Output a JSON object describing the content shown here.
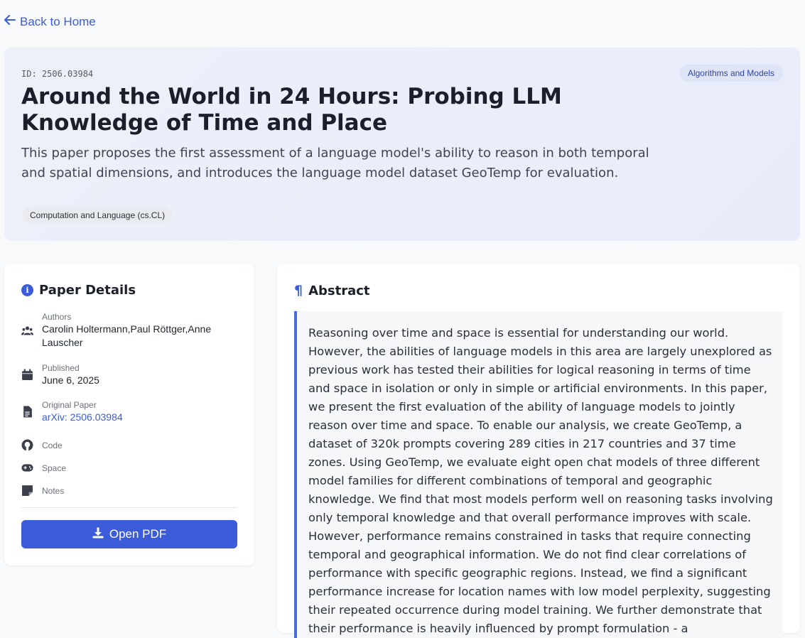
{
  "nav": {
    "back_label": "Back to Home"
  },
  "paper": {
    "id_label": "ID: 2506.03984",
    "category": "Algorithms and Models",
    "title": "Around the World in 24 Hours: Probing LLM Knowledge of Time and Place",
    "summary": "This paper proposes the first assessment of a language model's ability to reason in both temporal and spatial dimensions, and introduces the language model dataset GeoTemp for evaluation.",
    "subject": "Computation and Language (cs.CL)"
  },
  "details": {
    "heading": "Paper Details",
    "authors_label": "Authors",
    "authors": "Carolin Holtermann,Paul Röttger,Anne Lauscher",
    "published_label": "Published",
    "published": "June 6, 2025",
    "original_label": "Original Paper",
    "original_link": "arXiv: 2506.03984",
    "code_label": "Code",
    "space_label": "Space",
    "notes_label": "Notes",
    "open_pdf_label": "Open PDF"
  },
  "abstract": {
    "heading": "Abstract",
    "text": "Reasoning over time and space is essential for understanding our world. However, the abilities of language models in this area are largely unexplored as previous work has tested their abilities for logical reasoning in terms of time and space in isolation or only in simple or artificial environments. In this paper, we present the first evaluation of the ability of language models to jointly reason over time and space. To enable our analysis, we create GeoTemp, a dataset of 320k prompts covering 289 cities in 217 countries and 37 time zones. Using GeoTemp, we evaluate eight open chat models of three different model families for different combinations of temporal and geographic knowledge. We find that most models perform well on reasoning tasks involving only temporal knowledge and that overall performance improves with scale. However, performance remains constrained in tasks that require connecting temporal and geographical information. We do not find clear correlations of performance with specific geographic regions. Instead, we find a significant performance increase for location names with low model perplexity, suggesting their repeated occurrence during model training. We further demonstrate that their performance is heavily influenced by prompt formulation - a"
  },
  "icons": {
    "back": "arrow-left-icon",
    "info": "info-icon",
    "authors": "users-icon",
    "published": "calendar-icon",
    "original": "file-icon",
    "code": "github-icon",
    "space": "gamepad-icon",
    "notes": "sticky-note-icon",
    "pdf": "download-icon",
    "abstract": "paragraph-icon"
  },
  "colors": {
    "accent": "#3c5bd8",
    "page_bg": "#f8f9fb",
    "hero_bg": "#eef0f9"
  }
}
